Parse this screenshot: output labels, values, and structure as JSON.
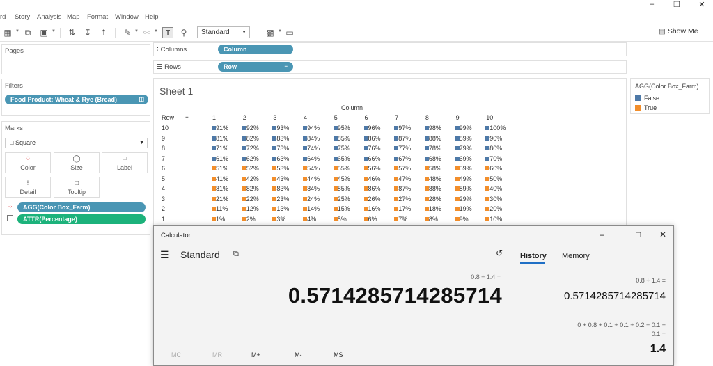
{
  "menu": [
    "rd",
    "Story",
    "Analysis",
    "Map",
    "Format",
    "Window",
    "Help"
  ],
  "toolbar": {
    "fit": "Standard",
    "show_me": "Show Me"
  },
  "shelves": {
    "columns_label": "Columns",
    "columns_pill": "Column",
    "rows_label": "Rows",
    "rows_pill": "Row"
  },
  "pages": {
    "title": "Pages"
  },
  "filters": {
    "title": "Filters",
    "pill": "Food Product: Wheat & Rye (Bread)"
  },
  "marks": {
    "title": "Marks",
    "mark_type": "Square",
    "buttons": [
      "Color",
      "Size",
      "Label",
      "Detail",
      "Tooltip"
    ],
    "pill_color": "AGG(Color Box_Farm)",
    "pill_label": "ATTR(Percentage)"
  },
  "sheet": {
    "title": "Sheet 1",
    "column_header": "Column",
    "row_header": "Row",
    "columns": [
      "1",
      "2",
      "3",
      "4",
      "5",
      "6",
      "7",
      "8",
      "9",
      "10"
    ],
    "rows": [
      {
        "row": "10",
        "cells": [
          "91%",
          "92%",
          "93%",
          "94%",
          "95%",
          "96%",
          "97%",
          "98%",
          "99%",
          "100%"
        ]
      },
      {
        "row": "9",
        "cells": [
          "81%",
          "82%",
          "83%",
          "84%",
          "85%",
          "86%",
          "87%",
          "88%",
          "89%",
          "90%"
        ]
      },
      {
        "row": "8",
        "cells": [
          "71%",
          "72%",
          "73%",
          "74%",
          "75%",
          "76%",
          "77%",
          "78%",
          "79%",
          "80%"
        ]
      },
      {
        "row": "7",
        "cells": [
          "61%",
          "62%",
          "63%",
          "64%",
          "65%",
          "66%",
          "67%",
          "68%",
          "69%",
          "70%"
        ]
      },
      {
        "row": "6",
        "cells": [
          "51%",
          "52%",
          "53%",
          "54%",
          "55%",
          "56%",
          "57%",
          "58%",
          "59%",
          "60%"
        ]
      },
      {
        "row": "5",
        "cells": [
          "41%",
          "42%",
          "43%",
          "44%",
          "45%",
          "46%",
          "47%",
          "48%",
          "49%",
          "50%"
        ]
      },
      {
        "row": "4",
        "cells": [
          "81%",
          "82%",
          "83%",
          "84%",
          "85%",
          "86%",
          "87%",
          "88%",
          "89%",
          "40%"
        ]
      },
      {
        "row": "3",
        "cells": [
          "21%",
          "22%",
          "23%",
          "24%",
          "25%",
          "26%",
          "27%",
          "28%",
          "29%",
          "30%"
        ]
      },
      {
        "row": "2",
        "cells": [
          "11%",
          "12%",
          "13%",
          "14%",
          "15%",
          "16%",
          "17%",
          "18%",
          "19%",
          "20%"
        ]
      },
      {
        "row": "1",
        "cells": [
          "1%",
          "2%",
          "3%",
          "4%",
          "5%",
          "6%",
          "7%",
          "8%",
          "9%",
          "10%"
        ]
      }
    ],
    "false_rows": [
      "10",
      "9",
      "8",
      "7"
    ],
    "colors": {
      "false": "#4e79a7",
      "true": "#f28e2b"
    }
  },
  "legend": {
    "title": "AGG(Color Box_Farm)",
    "items": [
      "False",
      "True"
    ]
  },
  "calculator": {
    "window_title": "Calculator",
    "mode": "Standard",
    "expression": "0.8 ÷ 1.4 =",
    "display": "0.5714285714285714",
    "memory_buttons": [
      "MC",
      "MR",
      "M+",
      "M-",
      "MS"
    ],
    "tabs": [
      "History",
      "Memory"
    ],
    "history": [
      {
        "expr": "0.8  ÷  1.4 =",
        "result": "0.5714285714285714"
      },
      {
        "expr_line1": "0  +  0.8  +  0.1  +  0.1  +  0.2  +  0.1  +",
        "expr_line2": "0.1 =",
        "result": "1.4"
      }
    ]
  }
}
